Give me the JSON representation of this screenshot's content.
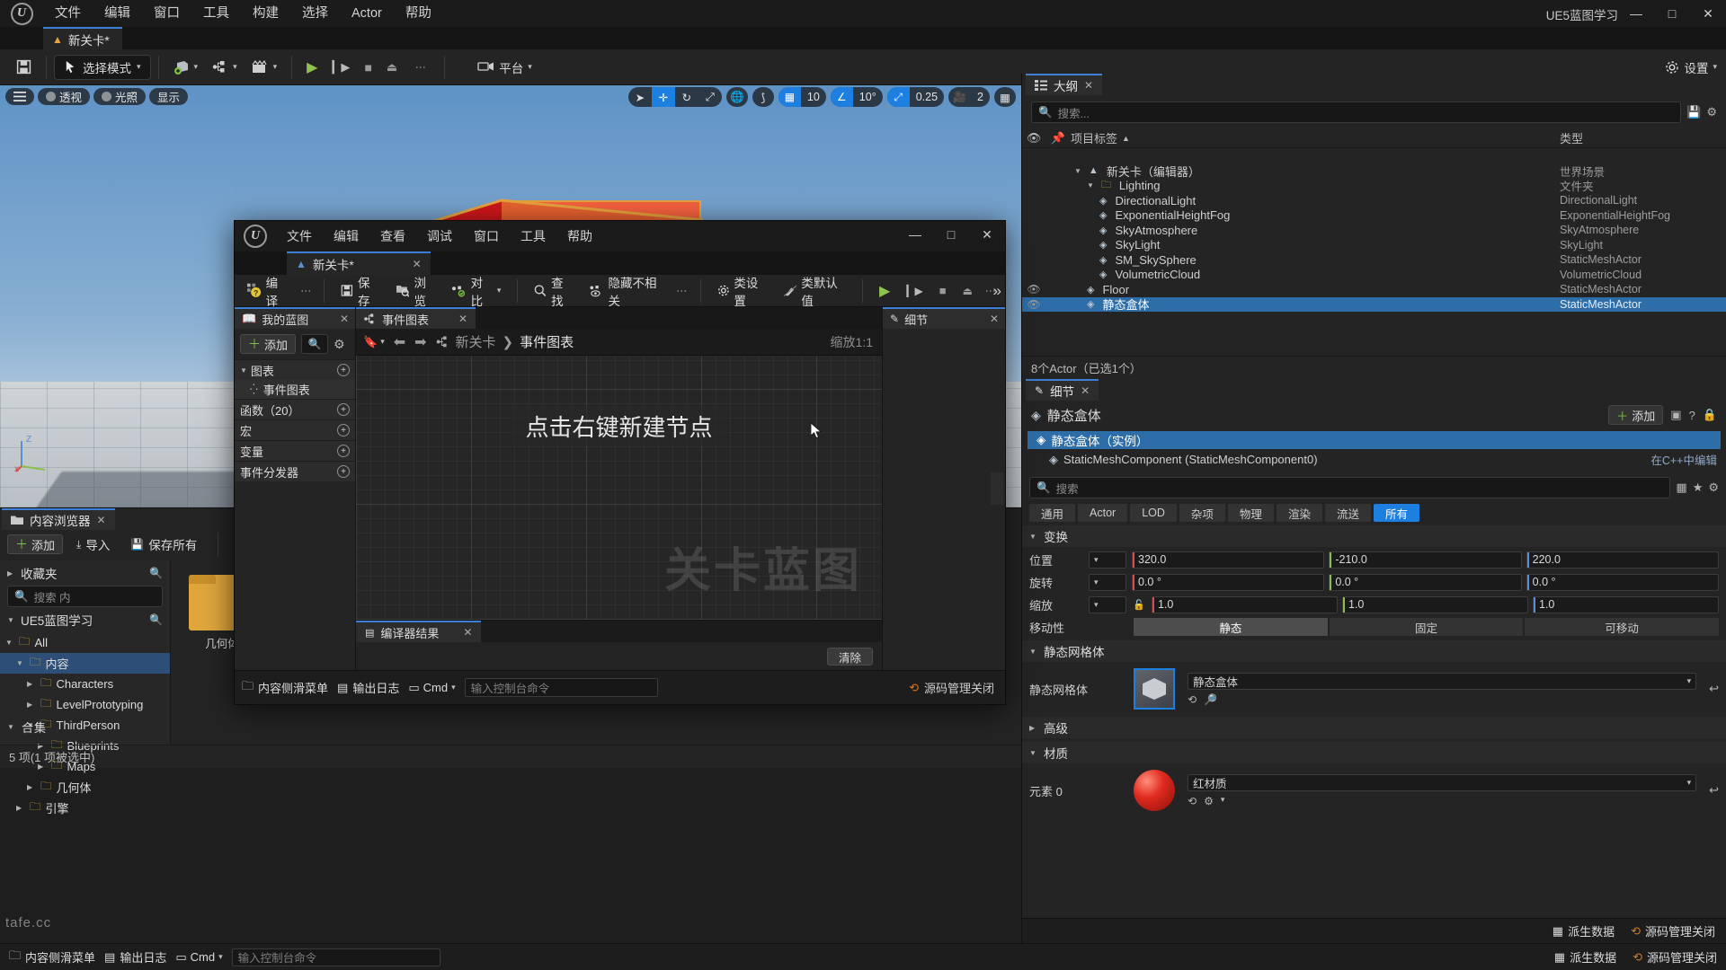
{
  "app": {
    "menus": [
      "文件",
      "编辑",
      "窗口",
      "工具",
      "构建",
      "选择",
      "Actor",
      "帮助"
    ],
    "project_label": "UE5蓝图学习",
    "level_tab": "新关卡*",
    "window_buttons": {
      "minimize": "—",
      "maximize": "□",
      "close": "✕"
    }
  },
  "toolbar": {
    "save_icon": "save-icon",
    "mode_label": "选择模式",
    "quick_add_icon": "add-actor-icon",
    "blueprint_icon": "blueprints-icon",
    "cinematics_icon": "cinematics-icon",
    "play_label": "播放",
    "platform_label": "平台",
    "settings_label": "设置"
  },
  "viewport": {
    "menu_icon": "viewport-menu-icon",
    "perspective": "透视",
    "lighting": "光照",
    "show": "显示",
    "gizmos": [
      "select-arrow-icon",
      "move-icon",
      "rotate-icon",
      "scale-icon"
    ],
    "active_gizmo_index": 1,
    "world_icon": "world-coordinate-icon",
    "surface_snap_icon": "surface-snap-icon",
    "grid_snap_value": "10",
    "angle_snap_value": "10°",
    "scale_snap_value": "0.25",
    "camera_speed_value": "2",
    "layout_icon": "viewport-layout-icon"
  },
  "content_browser": {
    "tab_label": "内容浏览器",
    "add_label": "添加",
    "import_label": "导入",
    "save_all_label": "保存所有",
    "back_icon": "back-arrow-icon",
    "forward_icon": "forward-arrow-icon",
    "path_icon": "folder-path-icon",
    "favorites_label": "收藏夹",
    "search_placeholder": "搜索 内",
    "project_root": "UE5蓝图学习",
    "tree": [
      {
        "label": "All",
        "depth": 0,
        "icon": "folder-icon",
        "expanded": true,
        "selected": false
      },
      {
        "label": "内容",
        "depth": 1,
        "icon": "folder-icon",
        "expanded": true,
        "selected": true
      },
      {
        "label": "Characters",
        "depth": 2,
        "icon": "folder-icon",
        "expanded": false,
        "selected": false
      },
      {
        "label": "LevelPrototyping",
        "depth": 2,
        "icon": "folder-icon",
        "expanded": false,
        "selected": false
      },
      {
        "label": "ThirdPerson",
        "depth": 2,
        "icon": "folder-icon",
        "expanded": true,
        "selected": false
      },
      {
        "label": "Blueprints",
        "depth": 3,
        "icon": "folder-icon",
        "expanded": false,
        "selected": false
      },
      {
        "label": "Maps",
        "depth": 3,
        "icon": "folder-icon",
        "expanded": false,
        "selected": false
      },
      {
        "label": "几何体",
        "depth": 2,
        "icon": "folder-icon",
        "expanded": false,
        "selected": false
      },
      {
        "label": "引擎",
        "depth": 1,
        "icon": "folder-icon",
        "expanded": false,
        "selected": false
      }
    ],
    "collections_label": "合集",
    "assets": [
      {
        "name": "几何体",
        "type": "folder"
      }
    ],
    "status": "5 项(1 项被选中)"
  },
  "bottom_bar": {
    "content_drawer": "内容侧滑菜单",
    "output_log": "输出日志",
    "cmd_label": "Cmd",
    "cmd_placeholder": "输入控制台命令",
    "derived_data": "派生数据",
    "source_control": "源码管理关闭"
  },
  "outliner": {
    "tab_label": "大纲",
    "search_placeholder": "搜索...",
    "col_item": "项目标签",
    "col_type": "类型",
    "sort_icon": "sort-asc-icon",
    "settings_icon": "outliner-settings-icon",
    "save_icon": "outliner-save-icon",
    "rows": [
      {
        "label": "新关卡（编辑器）",
        "type": "世界场景",
        "depth": 1,
        "icon": "level-icon",
        "expanded": true,
        "selected": false,
        "eye": false
      },
      {
        "label": "Lighting",
        "type": "文件夹",
        "depth": 2,
        "icon": "folder-icon",
        "expanded": true,
        "selected": false,
        "eye": false
      },
      {
        "label": "DirectionalLight",
        "type": "DirectionalLight",
        "depth": 3,
        "icon": "directional-light-icon",
        "selected": false,
        "eye": false
      },
      {
        "label": "ExponentialHeightFog",
        "type": "ExponentialHeightFog",
        "depth": 3,
        "icon": "fog-icon",
        "selected": false,
        "eye": false
      },
      {
        "label": "SkyAtmosphere",
        "type": "SkyAtmosphere",
        "depth": 3,
        "icon": "sky-atmosphere-icon",
        "selected": false,
        "eye": false
      },
      {
        "label": "SkyLight",
        "type": "SkyLight",
        "depth": 3,
        "icon": "sky-light-icon",
        "selected": false,
        "eye": false
      },
      {
        "label": "SM_SkySphere",
        "type": "StaticMeshActor",
        "depth": 3,
        "icon": "static-mesh-icon",
        "selected": false,
        "eye": false
      },
      {
        "label": "VolumetricCloud",
        "type": "VolumetricCloud",
        "depth": 3,
        "icon": "cloud-icon",
        "selected": false,
        "eye": false
      },
      {
        "label": "Floor",
        "type": "StaticMeshActor",
        "depth": 2,
        "icon": "static-mesh-icon",
        "selected": false,
        "eye": true
      },
      {
        "label": "静态盒体",
        "type": "StaticMeshActor",
        "depth": 2,
        "icon": "static-mesh-icon",
        "selected": true,
        "eye": true
      }
    ],
    "footer": "8个Actor（已选1个）"
  },
  "details": {
    "tab_label": "细节",
    "object_name": "静态盒体",
    "add_label": "添加",
    "blueprint_icon": "blueprint-convert-icon",
    "help_icon": "help-icon",
    "lock_icon": "lock-icon",
    "component_root": "静态盒体（实例）",
    "component_child": "StaticMeshComponent (StaticMeshComponent0)",
    "edit_in_cpp": "在C++中编辑",
    "search_placeholder": "搜索",
    "grid_icon": "grid-view-icon",
    "star_icon": "favorite-icon",
    "settings_icon": "details-settings-icon",
    "filter_tabs": [
      "通用",
      "Actor",
      "LOD",
      "杂项",
      "物理",
      "渲染",
      "流送",
      "所有"
    ],
    "active_filter": "所有",
    "sections": {
      "transform": "变换",
      "static_mesh": "静态网格体",
      "advanced": "高级",
      "materials": "材质"
    },
    "transform": {
      "location_label": "位置",
      "rotation_label": "旋转",
      "scale_label": "缩放",
      "mobility_label": "移动性",
      "location": [
        "320.0",
        "-210.0",
        "220.0"
      ],
      "rotation": [
        "0.0 °",
        "0.0 °",
        "0.0 °"
      ],
      "scale": [
        "1.0",
        "1.0",
        "1.0"
      ],
      "mobility_options": [
        "静态",
        "固定",
        "可移动"
      ],
      "mobility_active": "静态",
      "lock_icon": "scale-lock-icon",
      "reset_icon": "reset-arrow-icon"
    },
    "static_mesh": {
      "label": "静态网格体",
      "value": "静态盒体",
      "browse_icon": "browse-asset-icon",
      "search_icon": "find-asset-icon"
    },
    "material": {
      "element_label": "元素 0",
      "value": "红材质",
      "browse_icon": "browse-asset-icon",
      "settings_icon": "material-settings-icon",
      "reset_icon": "reset-arrow-icon"
    },
    "footer": {
      "derived_data": "派生数据",
      "source_control": "源码管理关闭"
    }
  },
  "blueprint_window": {
    "menus": [
      "文件",
      "编辑",
      "查看",
      "调试",
      "窗口",
      "工具",
      "帮助"
    ],
    "tab_label": "新关卡*",
    "window_buttons": {
      "minimize": "—",
      "maximize": "□",
      "close": "✕"
    },
    "toolbar": {
      "compile": "编译",
      "save": "保存",
      "browse": "浏览",
      "diff": "对比",
      "find": "查找",
      "hide_unrelated": "隐藏不相关",
      "class_settings": "类设置",
      "class_defaults": "类默认值",
      "play_icon": "play-icon",
      "step_icon": "step-icon",
      "stop_icon": "stop-icon",
      "eject_icon": "eject-icon",
      "more_icon": "more-options-icon",
      "expand_icon": "expand-toolbar-icon"
    },
    "my_blueprint": {
      "tab_label": "我的蓝图",
      "add_label": "添加",
      "search_icon": "search-icon",
      "settings_icon": "settings-icon",
      "categories": [
        {
          "label": "图表",
          "has_add": true,
          "expanded": true
        },
        {
          "label": "事件图表",
          "is_child": true,
          "icon": "event-graph-icon"
        },
        {
          "label": "函数（20）",
          "has_add": true
        },
        {
          "label": "宏",
          "has_add": true
        },
        {
          "label": "变量",
          "has_add": true
        },
        {
          "label": "事件分发器",
          "has_add": true
        }
      ]
    },
    "graph": {
      "tab_label": "事件图表",
      "bookmark_icon": "bookmark-icon",
      "back_icon": "back-arrow-icon",
      "forward_icon": "forward-arrow-icon",
      "graph_icon": "event-graph-icon",
      "breadcrumb_root": "新关卡",
      "breadcrumb_sep": "❯",
      "breadcrumb_leaf": "事件图表",
      "hint": "点击右键新建节点",
      "zoom_label": "缩放1:1",
      "watermark": "关卡蓝图"
    },
    "details_panel": {
      "tab_label": "细节"
    },
    "compiler_results": {
      "tab_label": "编译器结果",
      "clear_label": "清除"
    },
    "footer": {
      "content_drawer": "内容侧滑菜单",
      "output_log": "输出日志",
      "cmd_label": "Cmd",
      "cmd_placeholder": "输入控制台命令",
      "source_control": "源码管理关闭"
    }
  },
  "watermark": "tafe.cc"
}
